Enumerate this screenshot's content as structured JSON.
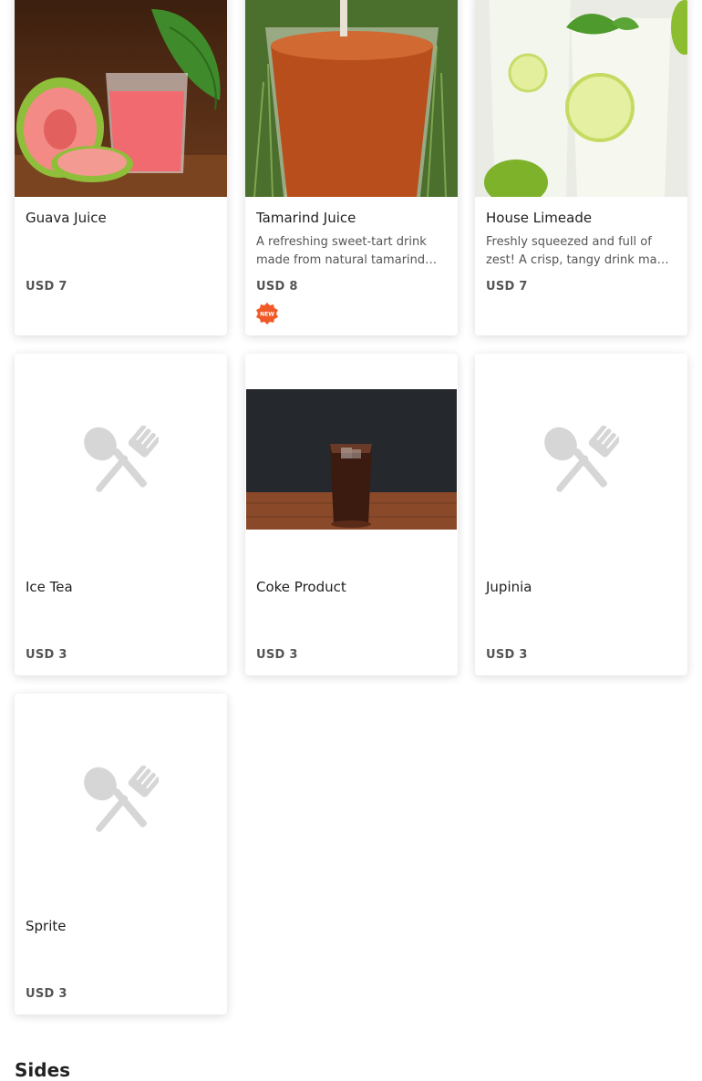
{
  "menu": {
    "items": [
      {
        "name": "Guava Juice",
        "description": "",
        "price": "USD 7",
        "image": "guava-juice-photo"
      },
      {
        "name": "Tamarind Juice",
        "description": "A refreshing sweet-tart drink made from natural tamarind pulp.",
        "price": "USD 8",
        "badge": "NEW",
        "image": "tamarind-juice-photo"
      },
      {
        "name": "House Limeade",
        "description": "Freshly squeezed and full of zest! A crisp, tangy drink made with fresh limes.",
        "price": "USD 7",
        "image": "limeade-photo"
      },
      {
        "name": "Ice Tea",
        "description": "",
        "price": "USD 3",
        "image": "placeholder-utensils"
      },
      {
        "name": "Coke Product",
        "description": "",
        "price": "USD 3",
        "image": "cola-glass-photo"
      },
      {
        "name": "Jupinia",
        "description": "",
        "price": "USD 3",
        "image": "placeholder-utensils"
      },
      {
        "name": "Sprite",
        "description": "",
        "price": "USD 3",
        "image": "placeholder-utensils"
      }
    ]
  },
  "sections": {
    "next_title": "Sides"
  },
  "colors": {
    "badge": "#f05a28",
    "placeholder_icon": "#d6d6d6",
    "price_text": "#555555"
  }
}
